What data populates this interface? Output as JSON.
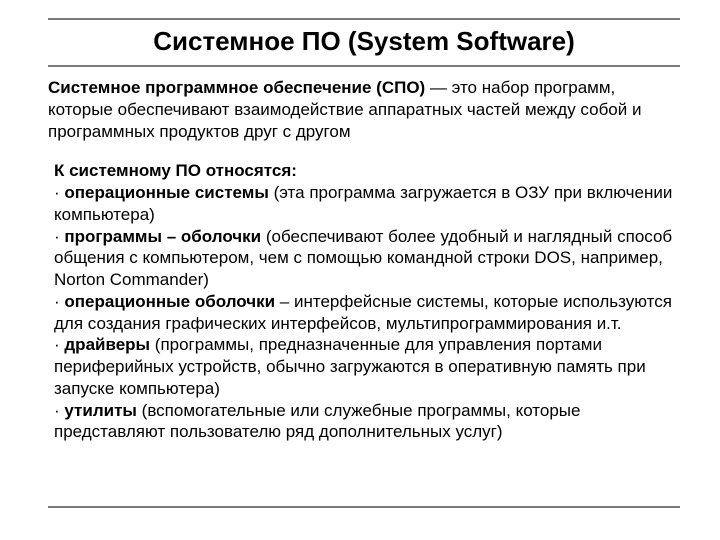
{
  "title": "Системное ПО (System Software)",
  "intro": {
    "lead_bold": "Системное программное обеспечение (СПО)",
    "lead_rest": " — это набор программ, которые обеспечивают взаимодействие аппаратных частей между собой и программных продуктов друг с другом"
  },
  "list": {
    "heading": "К системному ПО относятся:",
    "items": [
      {
        "bold": "операционные системы",
        "rest": " (эта программа загружается в ОЗУ при включении компьютера)"
      },
      {
        "bold": "программы – оболочки",
        "rest": " (обеспечивают более удобный и наглядный способ общения с компьютером, чем с помощью командной строки DOS, например, Norton Commander)"
      },
      {
        "bold": "операционные оболочки",
        "rest": " – интерфейсные системы, которые используются для создания графических интерфейсов, мультипрограммирования и.т."
      },
      {
        "bold": "драйверы",
        "rest": " (программы, предназначенные для управления портами периферийных устройств, обычно загружаются в оперативную память при запуске компьютера)"
      },
      {
        "bold": "утилиты",
        "rest": " (вспомогательные или служебные программы, которые представляют пользователю ряд дополнительных услуг)"
      }
    ],
    "bullet": "·  "
  }
}
